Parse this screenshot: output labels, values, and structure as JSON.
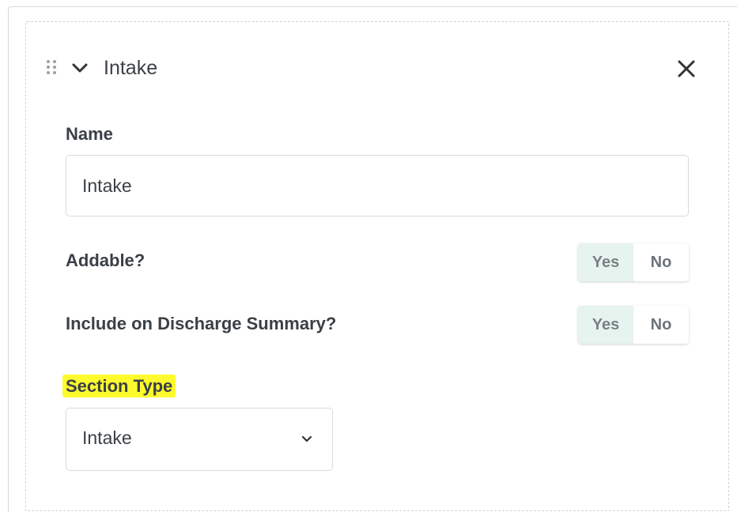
{
  "section": {
    "title": "Intake",
    "icons": {
      "drag": "drag-handle-icon",
      "collapse": "chevron-down-icon",
      "close": "close-icon"
    }
  },
  "fields": {
    "name": {
      "label": "Name",
      "value": "Intake"
    },
    "addable": {
      "label": "Addable?",
      "options": [
        "Yes",
        "No"
      ],
      "selected": "Yes"
    },
    "discharge": {
      "label": "Include on Discharge Summary?",
      "options": [
        "Yes",
        "No"
      ],
      "selected": "Yes"
    },
    "section_type": {
      "label": "Section Type",
      "value": "Intake",
      "highlight_color": "#fdfb2e"
    }
  },
  "colors": {
    "active_toggle_bg": "#e6f3ee",
    "border": "#d8dbde",
    "text": "#3a4046"
  }
}
